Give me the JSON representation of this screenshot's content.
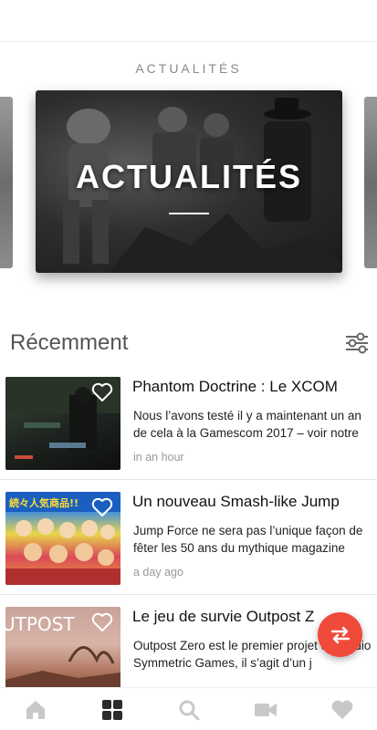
{
  "featured": {
    "section_label": "ACTUALITÉS",
    "hero_title": "ACTUALITÉS"
  },
  "recent": {
    "heading": "Récemment",
    "filter_icon": "sliders-icon"
  },
  "articles": [
    {
      "title": "Phantom Doctrine : Le XCOM",
      "excerpt": "Nous l’avons testé il y a maintenant un an de cela à la Gamescom 2017 – voir notre",
      "time": "in an hour"
    },
    {
      "title": "Un nouveau Smash-like Jump",
      "excerpt": "Jump Force ne sera pas l’unique façon de fêter les 50 ans du mythique magazine",
      "time": "a day ago",
      "thumb_text": "続々人気商品!!"
    },
    {
      "title": "Le jeu de survie Outpost Z",
      "excerpt": "Outpost Zero est le premier projet du studio Symmetric Games, il s’agit d’un j",
      "time": "",
      "thumb_text": "UTPOST"
    }
  ],
  "fab": {
    "icon": "swap-arrows-icon"
  },
  "bottom_nav": [
    {
      "icon": "home-icon"
    },
    {
      "icon": "grid-icon",
      "active": true
    },
    {
      "icon": "search-icon"
    },
    {
      "icon": "video-camera-icon"
    },
    {
      "icon": "heart-icon"
    }
  ],
  "colors": {
    "accent": "#f04a3a",
    "nav_active": "#2b2b2b",
    "nav_inactive": "#c8c8c8"
  }
}
